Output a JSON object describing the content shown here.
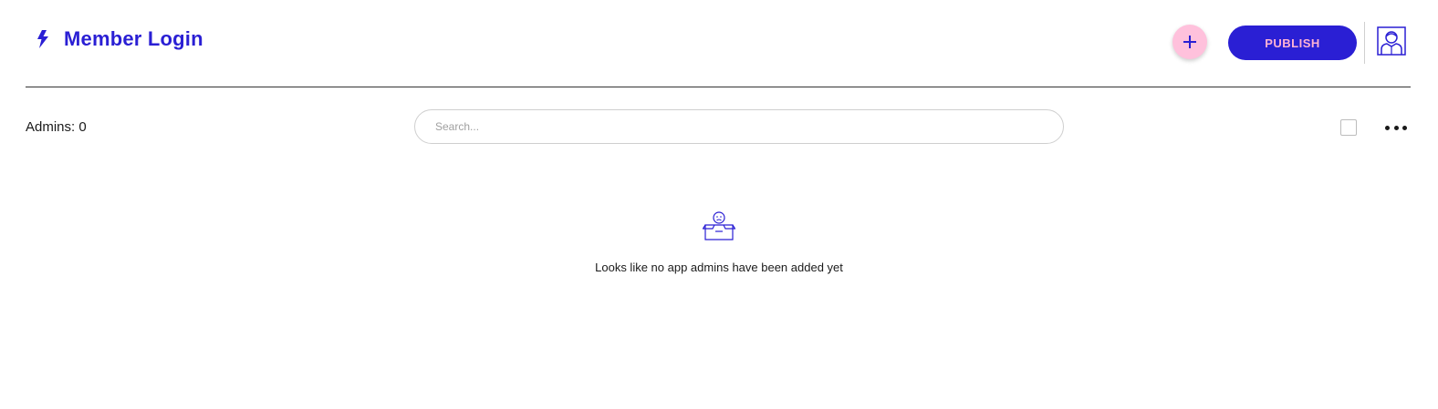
{
  "header": {
    "title": "Member Login",
    "publish_label": "PUBLISH",
    "bolt_icon": "lightning-bolt-icon",
    "add_icon": "plus-icon",
    "avatar_icon": "user-avatar-icon"
  },
  "toolbar": {
    "admins_label": "Admins: 0",
    "search_placeholder": "Search..."
  },
  "empty_state": {
    "icon": "sad-box-icon",
    "message": "Looks like no app admins have been added yet"
  },
  "colors": {
    "accent": "#2a1fd4",
    "pink": "#ffc1dc",
    "publish_text": "#ffb3d3"
  }
}
